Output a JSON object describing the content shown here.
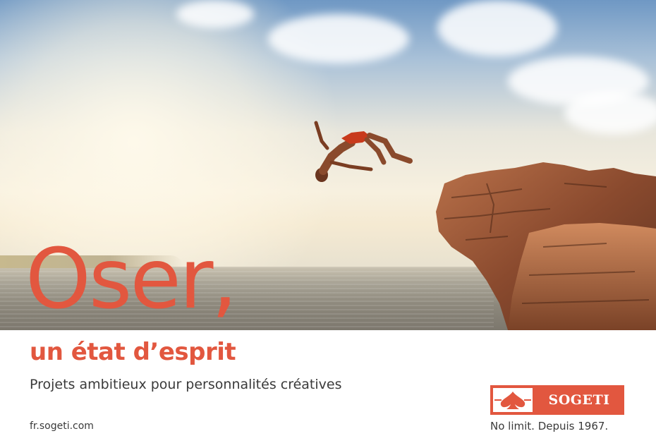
{
  "ad": {
    "headline": "Oser,",
    "subheadline": "un état d’esprit",
    "tagline": "Projets ambitieux pour personnalités créatives",
    "url": "fr.sogeti.com",
    "brand": {
      "name": "SOGETI",
      "slogan": "No limit. Depuis 1967."
    }
  },
  "colors": {
    "accent": "#e2573f",
    "text_dark": "#3a3a3a",
    "background": "#ffffff"
  },
  "icons": [
    "spade-logo-icon"
  ]
}
